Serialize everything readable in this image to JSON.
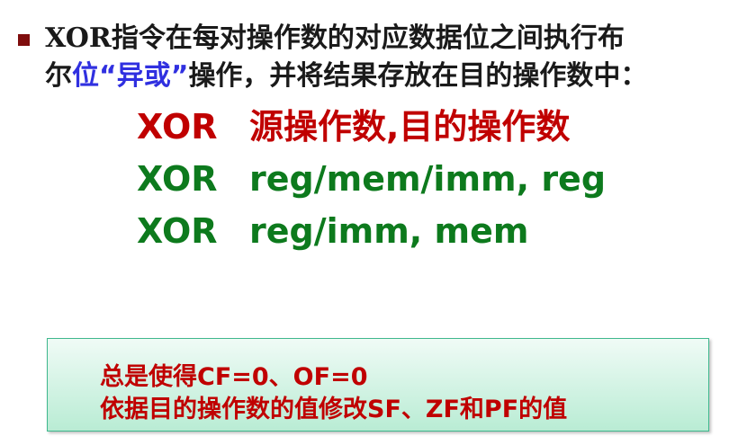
{
  "intro": {
    "part1": "XOR",
    "part2": "指令在每对操作数的对应数据位之间执行布",
    "part3": "尔",
    "highlight": "位“异或”",
    "part4": "操作，并将结果存放在目的操作数中："
  },
  "syntax": [
    {
      "mnemonic": "XOR",
      "operands": "源操作数,目的操作数"
    },
    {
      "mnemonic": "XOR",
      "operands": "reg/mem/imm, reg"
    },
    {
      "mnemonic": "XOR",
      "operands": "reg/imm, mem"
    }
  ],
  "flags": {
    "line1": "总是使得CF=0、OF=0",
    "line2": "依据目的操作数的值修改SF、ZF和PF的值"
  },
  "colors": {
    "bullet": "#7f0d0d",
    "highlight": "#3030e0",
    "red": "#c00000",
    "green": "#0d7a1d"
  }
}
